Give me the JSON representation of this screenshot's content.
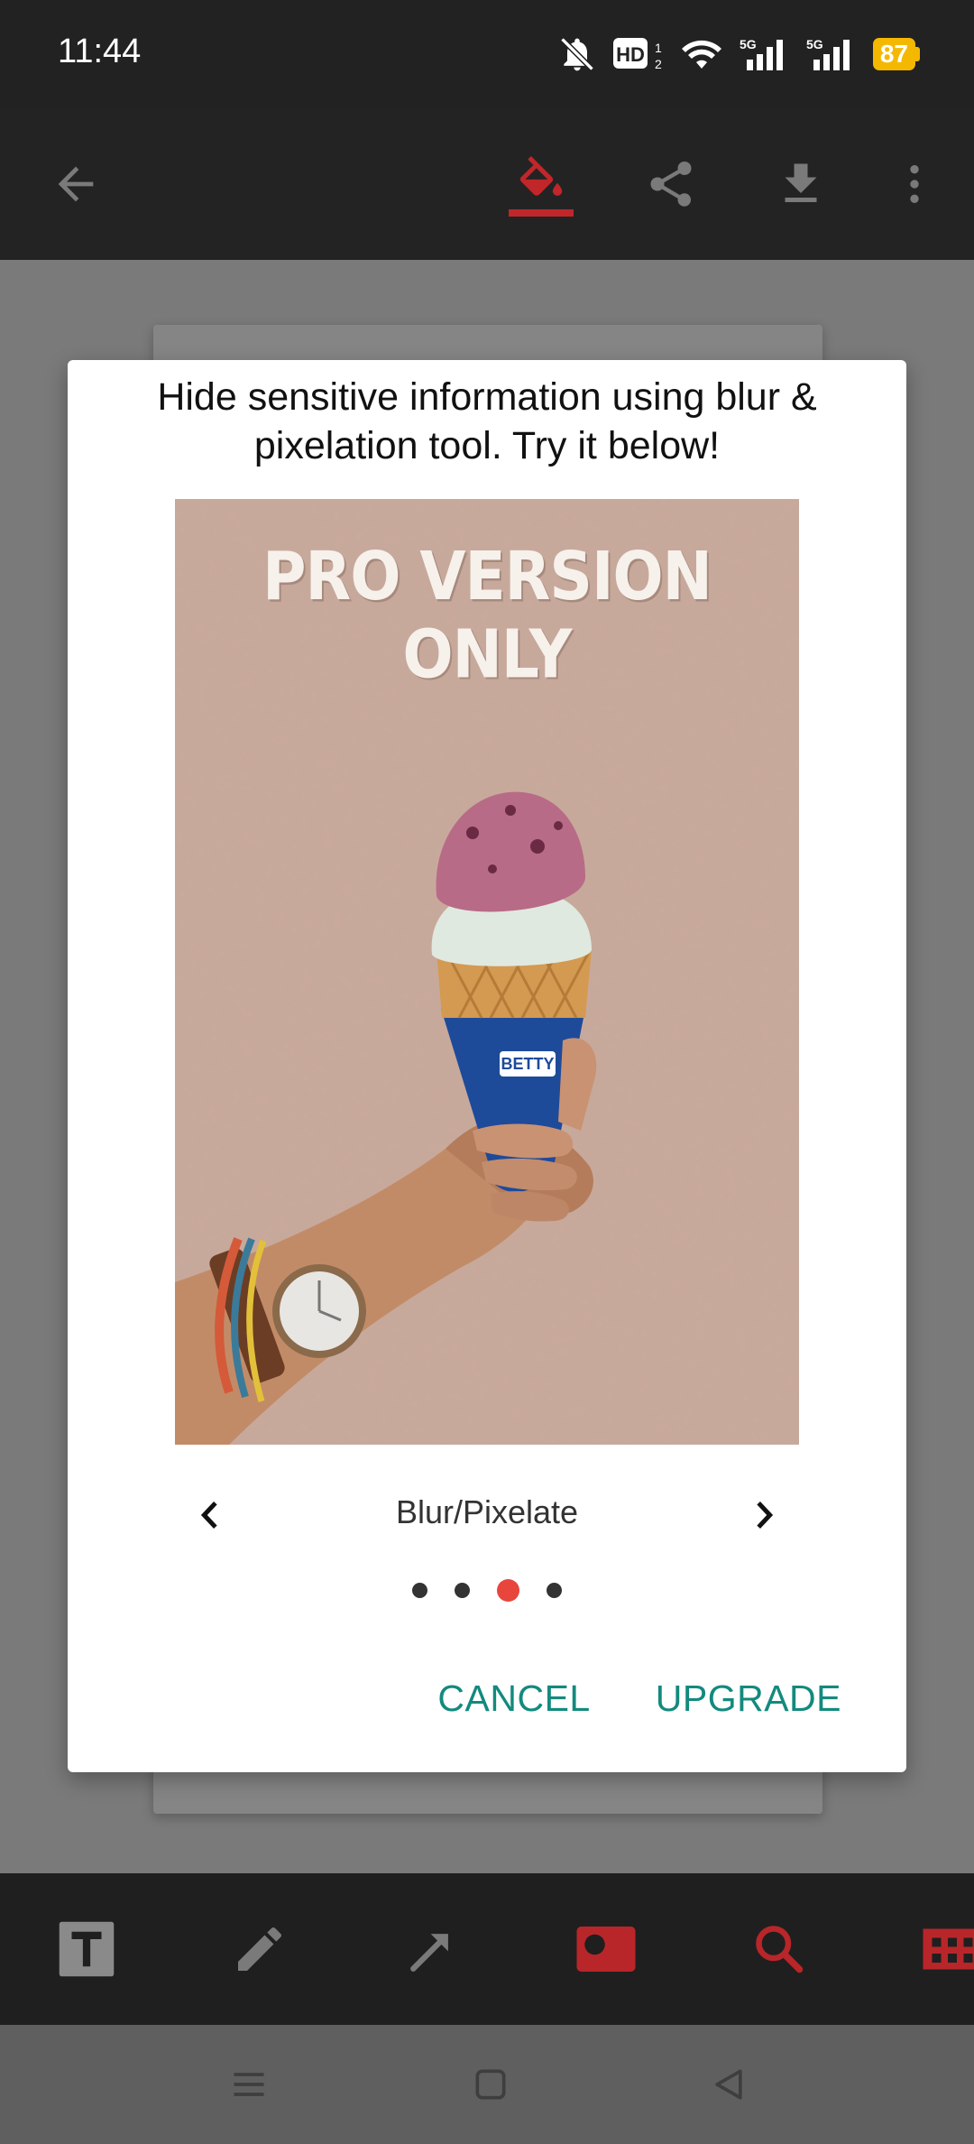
{
  "status_bar": {
    "time": "11:44",
    "battery": "87",
    "icons": [
      "bell-muted-icon",
      "hd-icon",
      "wifi-icon",
      "signal-5g-icon",
      "signal-5g-icon",
      "battery-icon"
    ]
  },
  "toolbar": {
    "icons": [
      "back-arrow-icon",
      "paint-bucket-icon",
      "share-icon",
      "download-icon",
      "more-vert-icon"
    ],
    "active_color": "#c0262a"
  },
  "dialog": {
    "title": "Hide sensitive information using blur & pixelation tool. Try it below!",
    "preview_overlay": "PRO VERSION ONLY",
    "preview_cup_text": "BETTY",
    "feature_label": "Blur/Pixelate",
    "page_count": 4,
    "active_page": 3,
    "cancel_label": "CANCEL",
    "upgrade_label": "UPGRADE",
    "accent_color": "#138a7e",
    "dot_active_color": "#e8453c"
  },
  "tools": {
    "icons": [
      "text-tool-icon",
      "pencil-tool-icon",
      "arrow-tool-icon",
      "blur-rect-tool-icon",
      "magnify-tool-icon",
      "pixelate-tool-icon"
    ]
  },
  "nav_bar": {
    "icons": [
      "menu-icon",
      "home-icon",
      "back-icon"
    ]
  }
}
